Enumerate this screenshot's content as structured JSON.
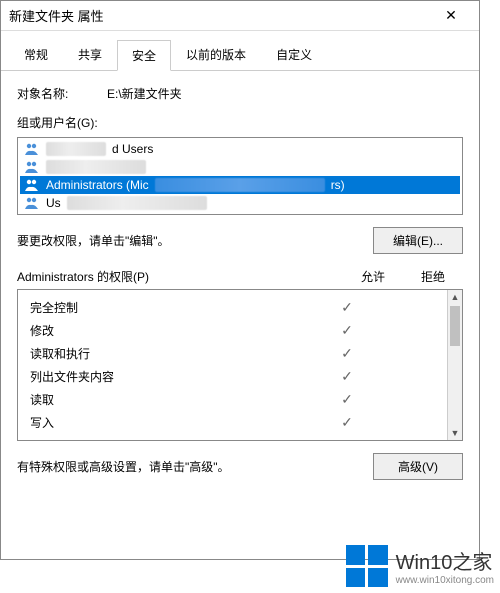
{
  "titlebar": {
    "title": "新建文件夹 属性"
  },
  "tabs": {
    "items": [
      "常规",
      "共享",
      "安全",
      "以前的版本",
      "自定义"
    ],
    "active": 2
  },
  "object": {
    "label": "对象名称:",
    "value": "E:\\新建文件夹"
  },
  "groups": {
    "label": "组或用户名(G):",
    "items": [
      {
        "name": "d Users"
      },
      {
        "name": ""
      },
      {
        "name": "Administrators (Mic",
        "tail": "rs)",
        "selected": true
      },
      {
        "name": "Us"
      }
    ]
  },
  "edit": {
    "hint": "要更改权限，请单击\"编辑\"。",
    "button": "编辑(E)..."
  },
  "permissions": {
    "label": "Administrators 的权限(P)",
    "col_allow": "允许",
    "col_deny": "拒绝",
    "rows": [
      {
        "name": "完全控制",
        "allow": true,
        "deny": false
      },
      {
        "name": "修改",
        "allow": true,
        "deny": false
      },
      {
        "name": "读取和执行",
        "allow": true,
        "deny": false
      },
      {
        "name": "列出文件夹内容",
        "allow": true,
        "deny": false
      },
      {
        "name": "读取",
        "allow": true,
        "deny": false
      },
      {
        "name": "写入",
        "allow": true,
        "deny": false
      }
    ]
  },
  "advanced": {
    "hint": "有特殊权限或高级设置，请单击\"高级\"。",
    "button": "高级(V)"
  },
  "watermark": {
    "line1": "Win10之家",
    "line2": "www.win10xitong.com"
  }
}
